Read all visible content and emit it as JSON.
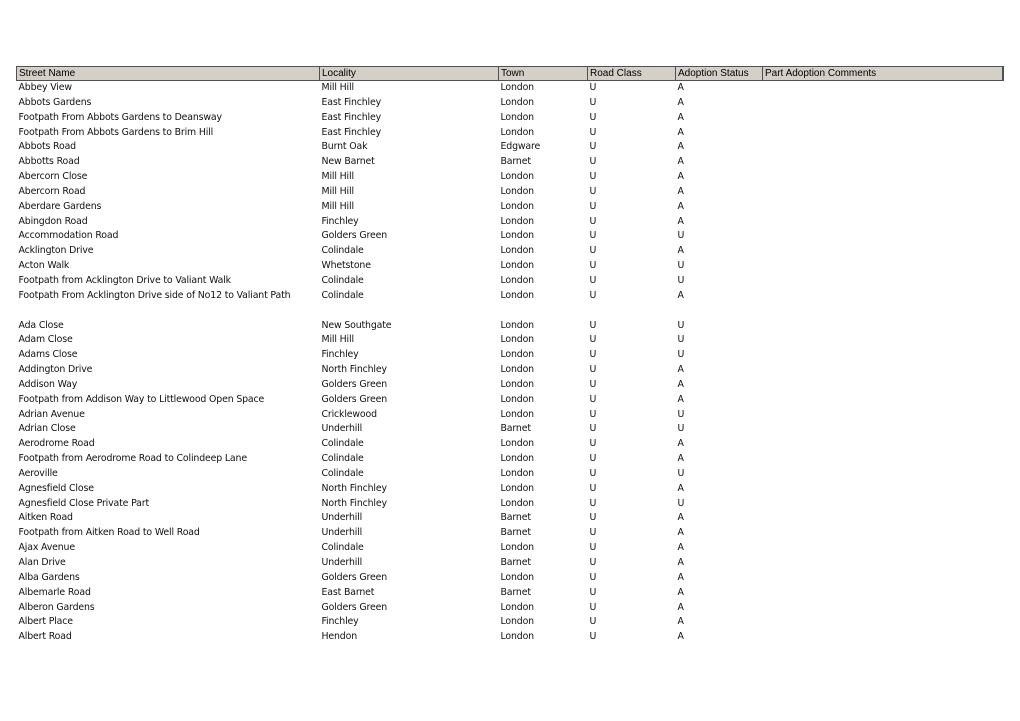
{
  "table": {
    "headers": [
      "Street Name",
      "Locality",
      "Town",
      "Road Class",
      "Adoption Status",
      "Part Adoption Comments"
    ],
    "rows": [
      [
        "Abbey View",
        "Mill Hill",
        "London",
        "U",
        "A",
        ""
      ],
      [
        "Abbots Gardens",
        "East Finchley",
        "London",
        "U",
        "A",
        ""
      ],
      [
        "Footpath From Abbots Gardens to Deansway",
        "East Finchley",
        "London",
        "U",
        "A",
        ""
      ],
      [
        "Footpath From Abbots Gardens to Brim Hill",
        "East Finchley",
        "London",
        "U",
        "A",
        ""
      ],
      [
        "Abbots Road",
        "Burnt Oak",
        "Edgware",
        "U",
        "A",
        ""
      ],
      [
        "Abbotts Road",
        "New Barnet",
        "Barnet",
        "U",
        "A",
        ""
      ],
      [
        "Abercorn Close",
        "Mill Hill",
        "London",
        "U",
        "A",
        ""
      ],
      [
        "Abercorn Road",
        "Mill Hill",
        "London",
        "U",
        "A",
        ""
      ],
      [
        "Aberdare Gardens",
        "Mill Hill",
        "London",
        "U",
        "A",
        ""
      ],
      [
        "Abingdon Road",
        "Finchley",
        "London",
        "U",
        "A",
        ""
      ],
      [
        "Accommodation Road",
        "Golders Green",
        "London",
        "U",
        "U",
        ""
      ],
      [
        "Acklington Drive",
        "Colindale",
        "London",
        "U",
        "A",
        ""
      ],
      [
        "Acton Walk",
        "Whetstone",
        "London",
        "U",
        "U",
        ""
      ],
      [
        "Footpath from Acklington Drive to Valiant Walk",
        "Colindale",
        "London",
        "U",
        "U",
        ""
      ],
      [
        "Footpath From Acklington Drive side of No12 to Valiant Path",
        "Colindale",
        "London",
        "U",
        "A",
        ""
      ],
      [
        "",
        "",
        "",
        "",
        "",
        ""
      ],
      [
        "Ada Close",
        "New Southgate",
        "London",
        "U",
        "U",
        ""
      ],
      [
        "Adam Close",
        "Mill Hill",
        "London",
        "U",
        "U",
        ""
      ],
      [
        "Adams Close",
        "Finchley",
        "London",
        "U",
        "U",
        ""
      ],
      [
        "Addington Drive",
        "North Finchley",
        "London",
        "U",
        "A",
        ""
      ],
      [
        "Addison Way",
        "Golders Green",
        "London",
        "U",
        "A",
        ""
      ],
      [
        "Footpath from Addison Way to Littlewood Open Space",
        "Golders Green",
        "London",
        "U",
        "A",
        ""
      ],
      [
        "Adrian Avenue",
        "Cricklewood",
        "London",
        "U",
        "U",
        ""
      ],
      [
        "Adrian Close",
        "Underhill",
        "Barnet",
        "U",
        "U",
        ""
      ],
      [
        "Aerodrome Road",
        "Colindale",
        "London",
        "U",
        "A",
        ""
      ],
      [
        "Footpath from Aerodrome Road to Colindeep Lane",
        "Colindale",
        "London",
        "U",
        "A",
        ""
      ],
      [
        "Aeroville",
        "Colindale",
        "London",
        "U",
        "U",
        ""
      ],
      [
        "Agnesfield Close",
        "North Finchley",
        "London",
        "U",
        "A",
        ""
      ],
      [
        "Agnesfield Close Private Part",
        "North Finchley",
        "London",
        "U",
        "U",
        ""
      ],
      [
        "Aitken Road",
        "Underhill",
        "Barnet",
        "U",
        "A",
        ""
      ],
      [
        "Footpath from Aitken Road to Well Road",
        "Underhill",
        "Barnet",
        "U",
        "A",
        ""
      ],
      [
        "Ajax Avenue",
        "Colindale",
        "London",
        "U",
        "A",
        ""
      ],
      [
        "Alan Drive",
        "Underhill",
        "Barnet",
        "U",
        "A",
        ""
      ],
      [
        "Alba Gardens",
        "Golders Green",
        "London",
        "U",
        "A",
        ""
      ],
      [
        "Albemarle Road",
        "East Barnet",
        "Barnet",
        "U",
        "A",
        ""
      ],
      [
        "Alberon Gardens",
        "Golders Green",
        "London",
        "U",
        "A",
        ""
      ],
      [
        "Albert Place",
        "Finchley",
        "London",
        "U",
        "A",
        ""
      ],
      [
        "Albert Road",
        "Hendon",
        "London",
        "U",
        "A",
        ""
      ]
    ]
  },
  "colors": {
    "header_background": "#d4d0c8",
    "header_border": "#505050"
  }
}
